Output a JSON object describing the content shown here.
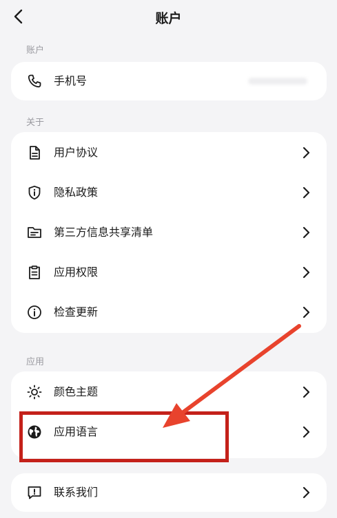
{
  "header": {
    "title": "账户"
  },
  "sections": {
    "account": {
      "label": "账户",
      "phone": "手机号"
    },
    "about": {
      "label": "关于",
      "items": [
        "用户协议",
        "隐私政策",
        "第三方信息共享清单",
        "应用权限",
        "检查更新"
      ]
    },
    "app": {
      "label": "应用",
      "items": [
        "颜色主题",
        "应用语言"
      ]
    },
    "contact": {
      "label": "联系我们"
    }
  },
  "annotation": {
    "color": "#e8432d",
    "box_color": "#c4211a"
  }
}
